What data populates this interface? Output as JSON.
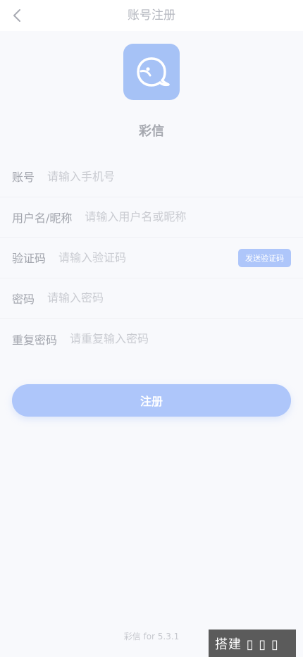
{
  "nav": {
    "title": "账号注册",
    "back_icon": "chevron-left-icon"
  },
  "app": {
    "logo_icon": "chat-bird-icon",
    "name": "彩信"
  },
  "form": {
    "account": {
      "label": "账号",
      "placeholder": "请输入手机号"
    },
    "username": {
      "label": "用户名/昵称",
      "placeholder": "请输入用户名或昵称"
    },
    "code": {
      "label": "验证码",
      "placeholder": "请输入验证码",
      "send_label": "发送验证码"
    },
    "password": {
      "label": "密码",
      "placeholder": "请输入密码"
    },
    "confirm": {
      "label": "重复密码",
      "placeholder": "请重复输入密码"
    }
  },
  "register_label": "注册",
  "version_text": "彩信 for 5.3.1",
  "watermark_text": "搭建 ▯ ▯ ▯",
  "colors": {
    "accent": "#aec6fa",
    "logo_bg": "#a6c2f6",
    "background": "#f8f9fc"
  }
}
